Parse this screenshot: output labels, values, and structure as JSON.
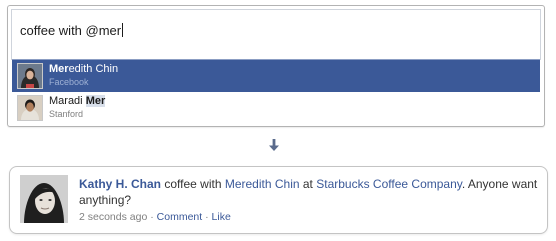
{
  "composer": {
    "input_value": "coffee with @mer"
  },
  "suggestions": [
    {
      "name_match": "Mer",
      "name_rest": "edith Chin",
      "subtitle": "Facebook",
      "selected": true
    },
    {
      "name_prefix": "Maradi ",
      "name_match": "Mer",
      "subtitle": "Stanford",
      "selected": false
    }
  ],
  "story": {
    "author": "Kathy H. Chan",
    "text_1": " coffee with ",
    "mention": "Meredith Chin",
    "text_2": " at ",
    "place": "Starbucks Coffee Company",
    "text_3": ". Anyone want anything?",
    "timestamp": "2 seconds ago",
    "separator": " · ",
    "comment_label": "Comment",
    "like_label": "Like"
  },
  "colors": {
    "accent": "#3b5998",
    "selected_row": "#3b5998",
    "highlight": "#d8dfea",
    "meta_gray": "#808080"
  },
  "icons": {
    "arrow": "arrow-down-icon"
  }
}
